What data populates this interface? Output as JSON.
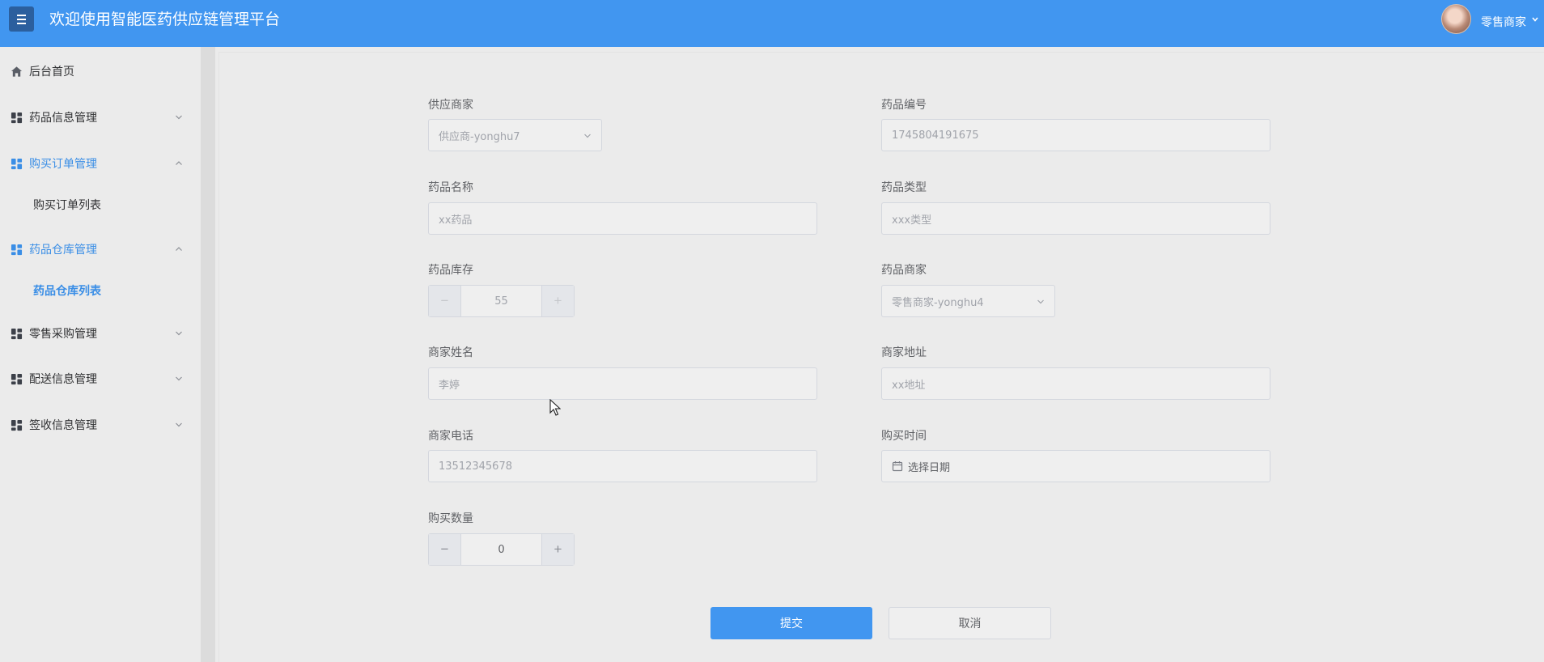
{
  "header": {
    "title": "欢迎使用智能医药供应链管理平台",
    "user_name": "零售商家"
  },
  "sidebar": {
    "items": [
      {
        "label": "后台首页"
      },
      {
        "label": "药品信息管理"
      },
      {
        "label": "购买订单管理"
      },
      {
        "label": "购买订单列表"
      },
      {
        "label": "药品仓库管理"
      },
      {
        "label": "药品仓库列表"
      },
      {
        "label": "零售采购管理"
      },
      {
        "label": "配送信息管理"
      },
      {
        "label": "签收信息管理"
      }
    ]
  },
  "form": {
    "supplier": {
      "label": "供应商家",
      "value": "供应商-yonghu7"
    },
    "drug_code": {
      "label": "药品编号",
      "value": "1745804191675"
    },
    "drug_name": {
      "label": "药品名称",
      "placeholder": "xx药品"
    },
    "drug_type": {
      "label": "药品类型",
      "placeholder": "xxx类型"
    },
    "stock": {
      "label": "药品库存",
      "value": "55",
      "minus": "−",
      "plus": "+"
    },
    "merchant": {
      "label": "药品商家",
      "value": "零售商家-yonghu4"
    },
    "merchant_name": {
      "label": "商家姓名",
      "value": "李婷"
    },
    "merchant_address": {
      "label": "商家地址",
      "placeholder": "xx地址"
    },
    "merchant_phone": {
      "label": "商家电话",
      "value": "13512345678"
    },
    "purchase_time": {
      "label": "购买时间",
      "placeholder": "选择日期"
    },
    "quantity": {
      "label": "购买数量",
      "value": "0",
      "minus": "−",
      "plus": "+"
    }
  },
  "actions": {
    "submit": "提交",
    "cancel": "取消"
  },
  "colors": {
    "topbar": "#4196f0",
    "accent": "#3a8ee6",
    "menu_button": "#2b5f9e"
  }
}
